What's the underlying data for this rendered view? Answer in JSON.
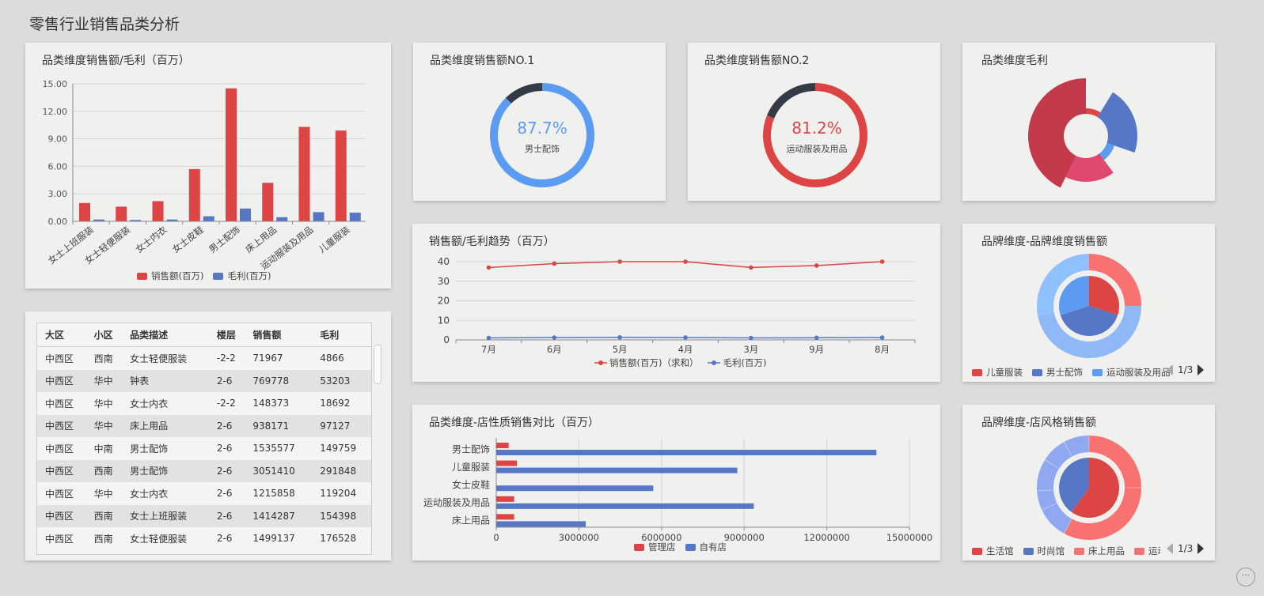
{
  "page_title": "零售行业销售品类分析",
  "help_icon_text": "···",
  "cards": {
    "bar_title": "品类维度销售额/毛利（百万）",
    "donut1_title": "品类维度销售额NO.1",
    "donut2_title": "品类维度销售额NO.2",
    "rose_title": "品类维度毛利",
    "line_title": "销售额/毛利趋势（百万）",
    "brand1_title": "品牌维度-品牌维度销售额",
    "hbar_title": "品类维度-店性质销售对比（百万）",
    "brand2_title": "品牌维度-店风格销售额"
  },
  "colors": {
    "red": "#dd4444",
    "blue": "#5577c5",
    "lightblue": "#5b9cf2",
    "dark": "#353b46",
    "pink": "#e0486e",
    "salmon": "#f87272",
    "paleblue": "#8fb8f7"
  },
  "chart_data": [
    {
      "type": "bar",
      "title": "品类维度销售额/毛利（百万）",
      "categories": [
        "女士上班服装",
        "女士轻便服装",
        "女士内衣",
        "女士皮鞋",
        "男士配饰",
        "床上用品",
        "运动服装及用品",
        "儿童服装"
      ],
      "series": [
        {
          "name": "销售额(百万)",
          "color": "#dd4444",
          "values": [
            2.0,
            1.6,
            2.2,
            5.7,
            14.5,
            4.2,
            10.3,
            9.9
          ]
        },
        {
          "name": "毛利(百万)",
          "color": "#5577c5",
          "values": [
            0.2,
            0.15,
            0.2,
            0.55,
            1.4,
            0.45,
            1.0,
            0.95
          ]
        }
      ],
      "yticks": [
        "0.00",
        "3.00",
        "6.00",
        "9.00",
        "12.00",
        "15.00"
      ],
      "ylim": [
        0,
        15
      ]
    },
    {
      "type": "pie",
      "title": "品类维度销售额NO.1",
      "value_text": "87.7%",
      "label": "男士配饰",
      "value": 87.7,
      "color": "#5b9cf2"
    },
    {
      "type": "pie",
      "title": "品类维度销售额NO.2",
      "value_text": "81.2%",
      "label": "运动服装及用品",
      "value": 81.2,
      "color": "#dd4444"
    },
    {
      "type": "pie",
      "title": "品类维度毛利",
      "rose": true,
      "slices": [
        {
          "value": 20,
          "color": "#dd4444"
        },
        {
          "value": 25,
          "color": "#5577c5"
        },
        {
          "value": 15,
          "color": "#5b9cf2"
        },
        {
          "value": 25,
          "color": "#e0486e"
        },
        {
          "value": 30,
          "color": "#c33a4b"
        }
      ]
    },
    {
      "type": "line",
      "title": "销售额/毛利趋势（百万）",
      "categories": [
        "7月",
        "6月",
        "5月",
        "4月",
        "3月",
        "9月",
        "8月"
      ],
      "series": [
        {
          "name": "销售额(百万)（求和）",
          "color": "#dd4444",
          "values": [
            37,
            39,
            40,
            40,
            37,
            38,
            40
          ]
        },
        {
          "name": "毛利(百万)",
          "color": "#5577c5",
          "values": [
            1,
            1.2,
            1.3,
            1.2,
            1,
            1.1,
            1.2
          ]
        }
      ],
      "yticks": [
        "0",
        "10",
        "20",
        "30",
        "40"
      ],
      "ylim": [
        0,
        40
      ]
    },
    {
      "type": "pie",
      "title": "品牌维度-品牌维度销售额",
      "inner": [
        {
          "value": 30,
          "color": "#dd4444"
        },
        {
          "value": 40,
          "color": "#5577c5"
        },
        {
          "value": 30,
          "color": "#5b9cf2"
        }
      ],
      "outer": [
        {
          "value": 25,
          "color": "#f87272"
        },
        {
          "value": 47,
          "color": "#8fb8f7"
        },
        {
          "value": 28,
          "color": "#8fc0ff"
        }
      ],
      "legend": [
        {
          "name": "儿童服装",
          "color": "#dd4444"
        },
        {
          "name": "男士配饰",
          "color": "#5577c5"
        },
        {
          "name": "运动服装及用品",
          "color": "#5b9cf2"
        }
      ],
      "page": "1/3"
    },
    {
      "type": "bar",
      "title": "品类维度-店性质销售对比（百万）",
      "orientation": "horizontal",
      "categories": [
        "男士配饰",
        "儿童服装",
        "女士皮鞋",
        "运动服装及用品",
        "床上用品"
      ],
      "series": [
        {
          "name": "管理店",
          "color": "#dd4444",
          "values": [
            450000,
            750000,
            0,
            650000,
            650000
          ]
        },
        {
          "name": "自有店",
          "color": "#5577c5",
          "values": [
            13800000,
            8750000,
            5700000,
            9350000,
            3250000
          ]
        }
      ],
      "xticks": [
        "0",
        "3000000",
        "6000000",
        "9000000",
        "12000000",
        "15000000"
      ],
      "xlim": [
        0,
        15000000
      ]
    },
    {
      "type": "pie",
      "title": "品牌维度-店风格销售额",
      "inner": [
        {
          "value": 60,
          "color": "#dd4444"
        },
        {
          "value": 40,
          "color": "#5577c5"
        }
      ],
      "outer": [
        {
          "value": 25,
          "color": "#f87272"
        },
        {
          "value": 33,
          "color": "#f87272"
        },
        {
          "value": 10,
          "color": "#8fa8f0"
        },
        {
          "value": 6,
          "color": "#8fa8f0"
        },
        {
          "value": 10,
          "color": "#8fa8f0"
        },
        {
          "value": 8,
          "color": "#8fa8f0"
        },
        {
          "value": 8,
          "color": "#8fa8f0"
        }
      ],
      "legend": [
        {
          "name": "生活馆",
          "color": "#dd4444"
        },
        {
          "name": "时尚馆",
          "color": "#5577c5"
        },
        {
          "name": "床上用品",
          "color": "#f87272"
        },
        {
          "name": "运动",
          "color": "#f87272"
        }
      ],
      "page": "1/3"
    }
  ],
  "table": {
    "headers": [
      "大区",
      "小区",
      "品类描述",
      "楼层",
      "销售额",
      "毛利"
    ],
    "rows": [
      [
        "中西区",
        "西南",
        "女士轻便服装",
        "-2-2",
        "71967",
        "4866"
      ],
      [
        "中西区",
        "华中",
        "钟表",
        "2-6",
        "769778",
        "53203"
      ],
      [
        "中西区",
        "华中",
        "女士内衣",
        "-2-2",
        "148373",
        "18692"
      ],
      [
        "中西区",
        "华中",
        "床上用品",
        "2-6",
        "938171",
        "97127"
      ],
      [
        "中西区",
        "中南",
        "男士配饰",
        "2-6",
        "1535577",
        "149759"
      ],
      [
        "中西区",
        "西南",
        "男士配饰",
        "2-6",
        "3051410",
        "291848"
      ],
      [
        "中西区",
        "华中",
        "女士内衣",
        "2-6",
        "1215858",
        "119204"
      ],
      [
        "中西区",
        "西南",
        "女士上班服装",
        "2-6",
        "1414287",
        "154398"
      ],
      [
        "中西区",
        "西南",
        "女士轻便服装",
        "2-6",
        "1499137",
        "176528"
      ]
    ]
  }
}
